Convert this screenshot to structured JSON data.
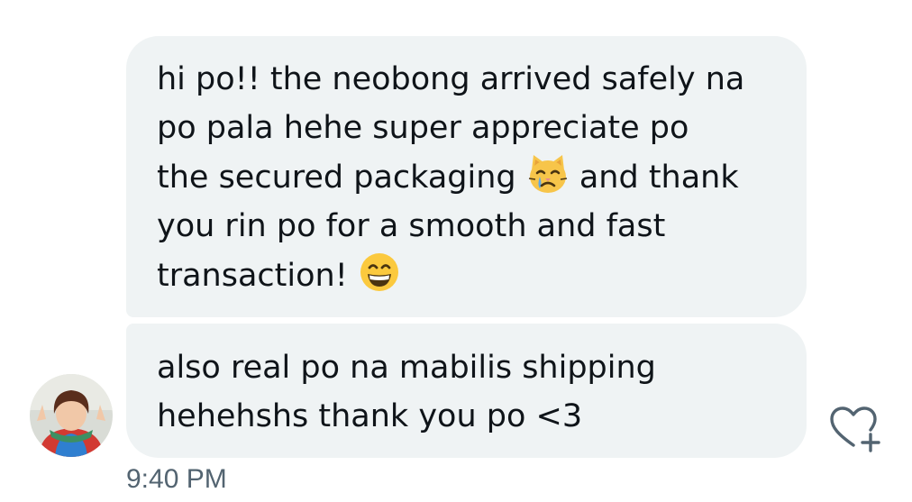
{
  "messages": [
    {
      "lines": [
        {
          "text": "hi po!! the neobong arrived safely na"
        },
        {
          "text": "po pala hehe super appreciate po"
        },
        {
          "text": "the secured packaging ",
          "emoji": "crying-cat-emoji",
          "after": " and thank"
        },
        {
          "text": "you rin po for a smooth and fast"
        },
        {
          "text": "transaction! ",
          "emoji": "grinning-face-emoji"
        }
      ]
    },
    {
      "lines": [
        {
          "text": "also real po na mabilis shipping"
        },
        {
          "text": "hehehshs thank you po <3"
        }
      ]
    }
  ],
  "timestamp": "9:40 PM",
  "sender": {
    "avatar_icon": "user-avatar"
  },
  "actions": {
    "react_icon": "add-reaction-heart-icon"
  },
  "colors": {
    "bubble_bg": "#eff3f4",
    "text": "#0f1419",
    "timestamp": "#536471",
    "icon": "#536471"
  }
}
